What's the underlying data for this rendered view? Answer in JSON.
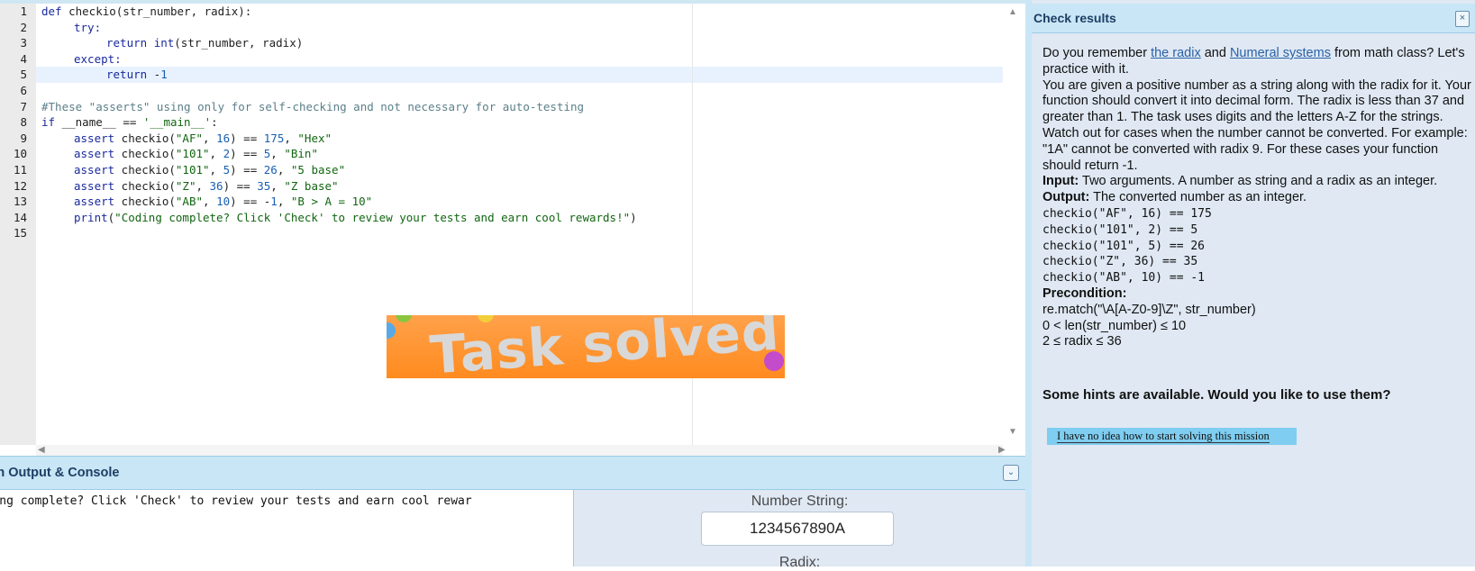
{
  "editor": {
    "line_numbers": [
      "1",
      "2",
      "3",
      "4",
      "5",
      "6",
      "7",
      "8",
      "9",
      "10",
      "11",
      "12",
      "13",
      "14",
      "15"
    ],
    "code": {
      "l1_kw": "def",
      "l1_rest": " checkio(str_number, radix):",
      "l2_kw": "try:",
      "l3_kw": "return",
      "l3_a": " ",
      "l3_int": "int",
      "l3_b": "(str_number, radix)",
      "l4_kw": "except:",
      "l5_kw": "return",
      "l5_b": " -",
      "l5_num": "1",
      "l7_cmt": "#These \"asserts\" using only for self-checking and not necessary for auto-testing",
      "l8_kw": "if",
      "l8_a": " __name__ == ",
      "l8_str": "'__main__'",
      "l8_b": ":",
      "l9_kw": "assert",
      "l9_a": " checkio(",
      "l9_s1": "\"AF\"",
      "l9_b": ", ",
      "l9_n1": "16",
      "l9_c": ") == ",
      "l9_n2": "175",
      "l9_d": ", ",
      "l9_s2": "\"Hex\"",
      "l10_kw": "assert",
      "l10_a": " checkio(",
      "l10_s1": "\"101\"",
      "l10_b": ", ",
      "l10_n1": "2",
      "l10_c": ") == ",
      "l10_n2": "5",
      "l10_d": ", ",
      "l10_s2": "\"Bin\"",
      "l11_kw": "assert",
      "l11_a": " checkio(",
      "l11_s1": "\"101\"",
      "l11_b": ", ",
      "l11_n1": "5",
      "l11_c": ") == ",
      "l11_n2": "26",
      "l11_d": ", ",
      "l11_s2": "\"5 base\"",
      "l12_kw": "assert",
      "l12_a": " checkio(",
      "l12_s1": "\"Z\"",
      "l12_b": ", ",
      "l12_n1": "36",
      "l12_c": ") == ",
      "l12_n2": "35",
      "l12_d": ", ",
      "l12_s2": "\"Z base\"",
      "l13_kw": "assert",
      "l13_a": " checkio(",
      "l13_s1": "\"AB\"",
      "l13_b": ", ",
      "l13_n1": "10",
      "l13_c": ") == -",
      "l13_n2": "1",
      "l13_d": ", ",
      "l13_s2": "\"B > A = 10\"",
      "l14_kw": "print",
      "l14_a": "(",
      "l14_s": "\"Coding complete? Click 'Check' to review your tests and earn cool rewards!\"",
      "l14_b": ")"
    },
    "banner_text": "Task solved!",
    "scroll_up_icon": "▲",
    "scroll_down_icon": "▼",
    "scroll_left_icon": "◀",
    "scroll_right_icon": "▶"
  },
  "console": {
    "title": "Run Output & Console",
    "output": "Coding complete? Click 'Check' to review your tests and earn cool rewar\nds!",
    "collapse_icon": "chevron-double-down-icon",
    "collapse_glyph": "⌄"
  },
  "form": {
    "number_label": "Number String:",
    "number_value": "1234567890A",
    "radix_label": "Radix:"
  },
  "check_results": {
    "title": "Check results",
    "close_glyph": "×",
    "intro_1": "Do you remember ",
    "link_radix": "the radix",
    "intro_and": " and ",
    "link_numeral": "Numeral systems",
    "intro_2": " from math class? Let's practice with it.",
    "para_2": "You are given a positive number as a string along with the radix for it. Your function should convert it into decimal form. The radix is less than 37 and greater than 1. The task uses digits and the letters A-Z for the strings.",
    "para_3": "Watch out for cases when the number cannot be converted. For example: \"1A\" cannot be converted with radix 9. For these cases your function should return -1.",
    "input_label": "Input:",
    "input_text": " Two arguments. A number as string and a radix as an integer.",
    "output_label": "Output:",
    "output_text": " The converted number as an integer.",
    "examples": [
      "checkio(\"AF\", 16) == 175",
      "checkio(\"101\", 2) == 5",
      "checkio(\"101\", 5) == 26",
      "checkio(\"Z\", 36) == 35",
      "checkio(\"AB\", 10) == -1"
    ],
    "precondition_label": "Precondition:",
    "preconditions": [
      "re.match(\"\\A[A-Z0-9]\\Z\", str_number)",
      "0 < len(str_number) ≤ 10",
      "2 ≤ radix ≤ 36"
    ],
    "hints_prompt": "Some hints are available. Would you like to use them?",
    "hint_button": "I have no idea how to start solving this mission"
  }
}
